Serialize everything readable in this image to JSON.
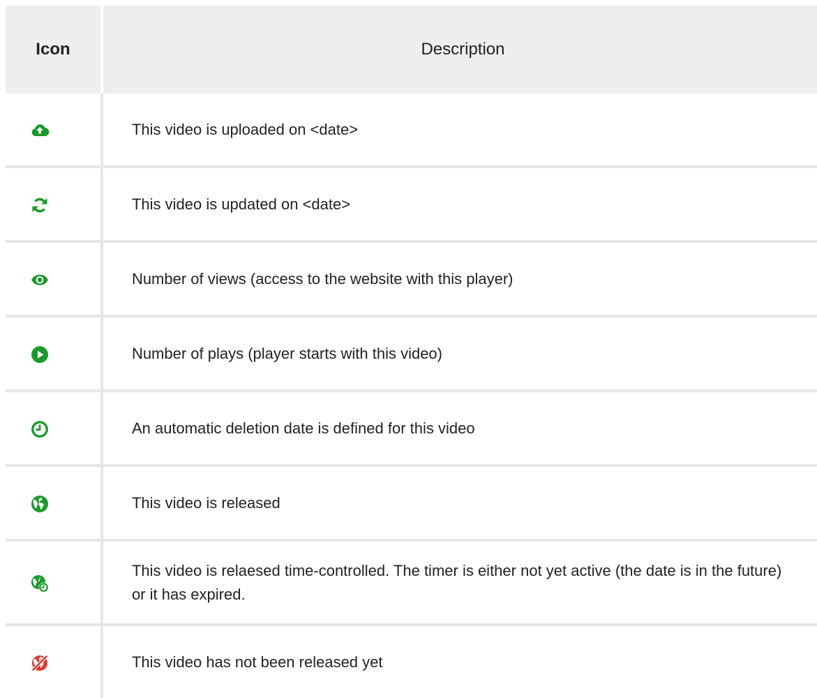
{
  "colors": {
    "green": "#1a9a2a",
    "red": "#e0392e",
    "header_bg": "#eeeeee",
    "divider": "#e6e6e6"
  },
  "table": {
    "headers": {
      "icon": "Icon",
      "description": "Description"
    },
    "rows": [
      {
        "icon": "cloud-upload-icon",
        "description": "This video is uploaded on <date>"
      },
      {
        "icon": "refresh-icon",
        "description": "This video is updated on <date>"
      },
      {
        "icon": "eye-icon",
        "description": "Number of views (access to the website with this player)"
      },
      {
        "icon": "play-circle-icon",
        "description": "Number of plays (player starts with this video)"
      },
      {
        "icon": "clock-icon",
        "description": "An automatic deletion date is defined for this video"
      },
      {
        "icon": "globe-icon",
        "description": "This video is released"
      },
      {
        "icon": "globe-clock-icon",
        "description": "This video is relaesed time-controlled. The timer is either not yet active (the date is in the future) or it has expired."
      },
      {
        "icon": "globe-disabled-icon",
        "description": "This video has not been released yet"
      }
    ]
  }
}
